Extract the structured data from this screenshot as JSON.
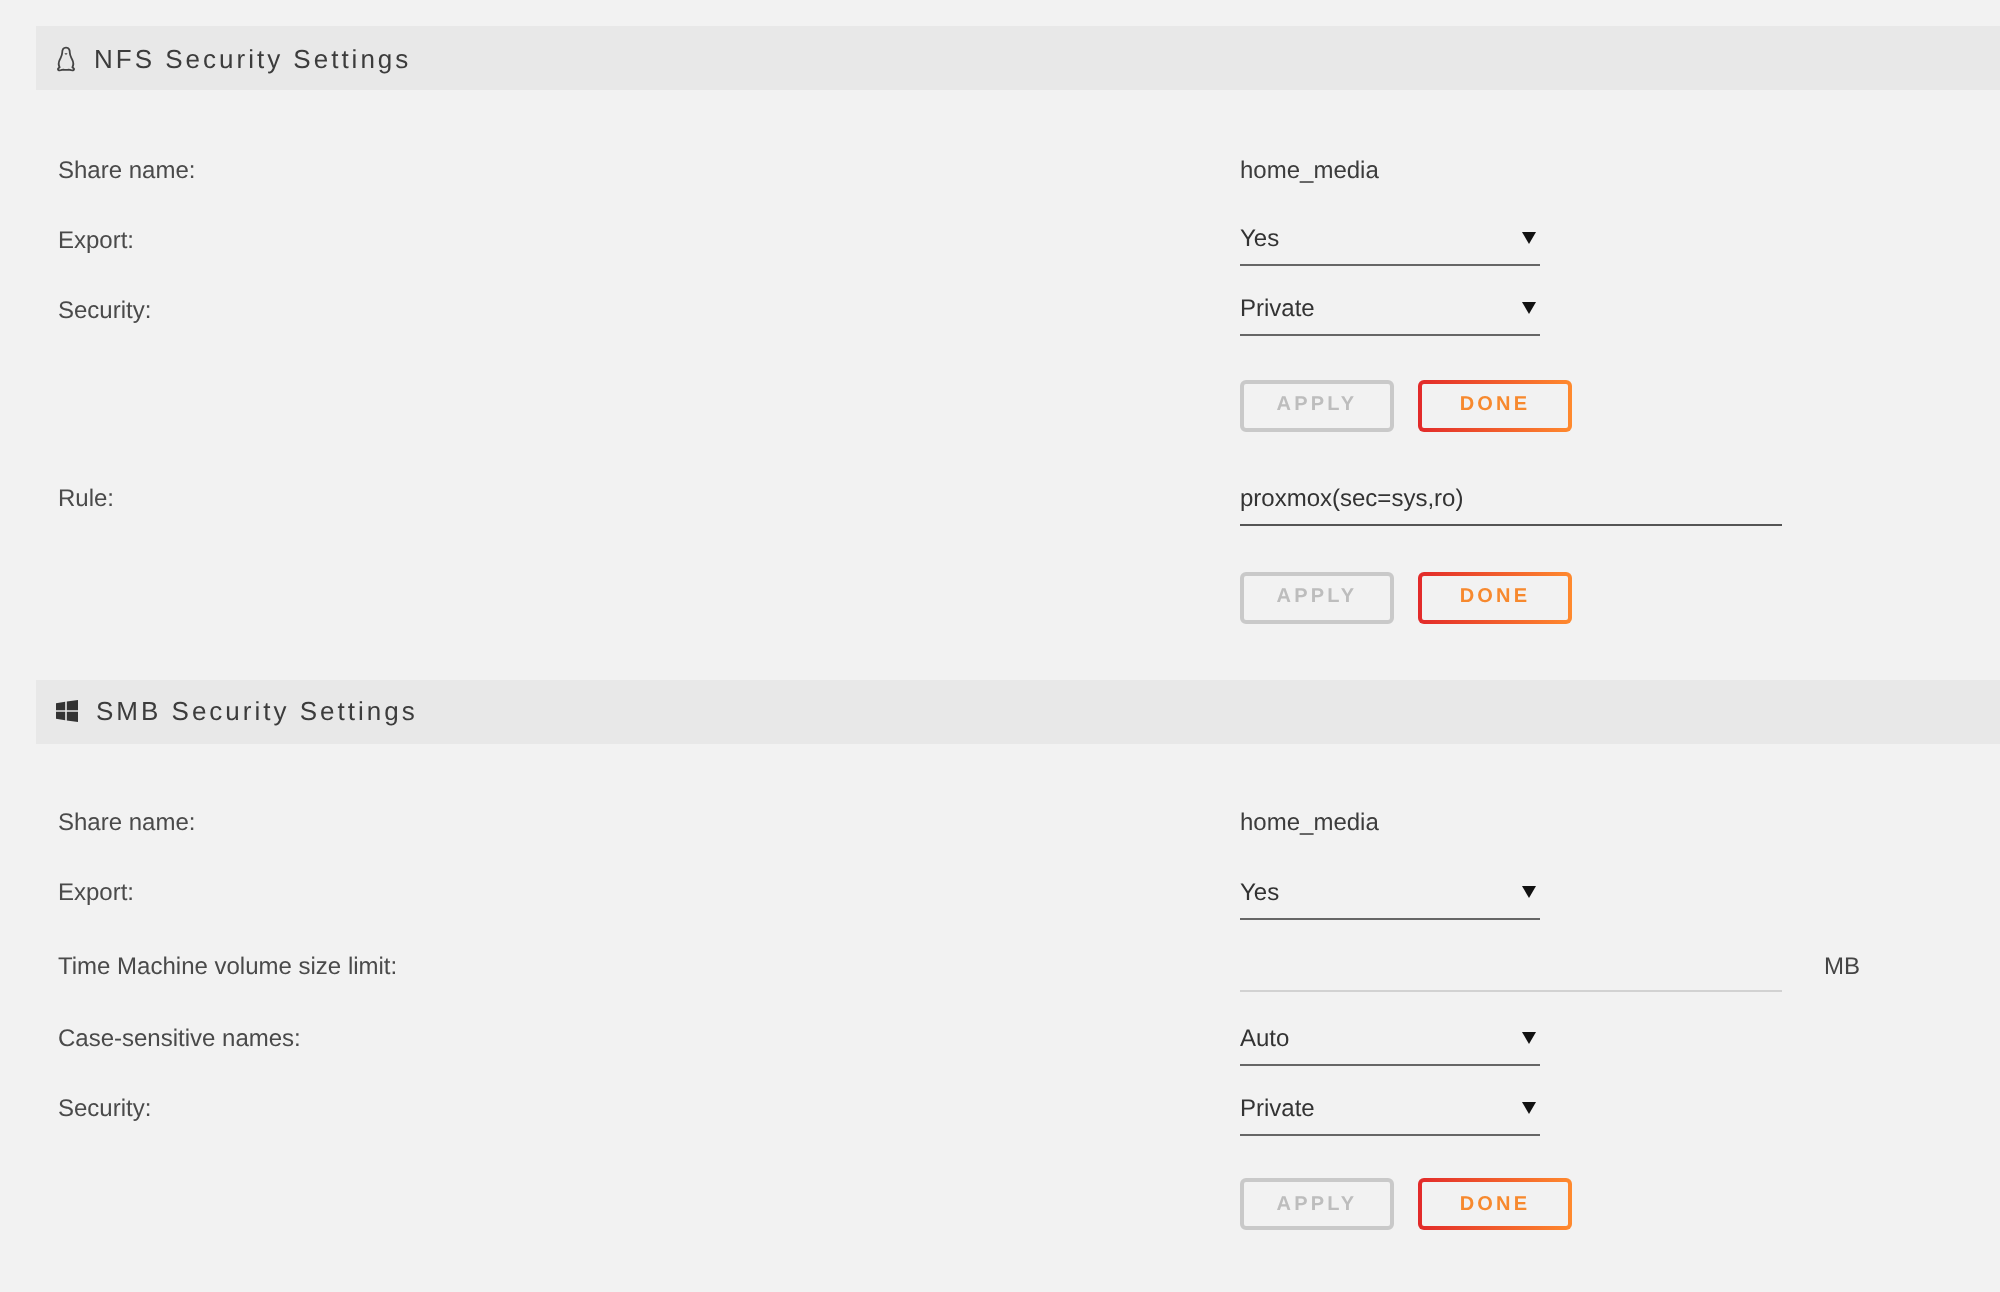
{
  "sections": [
    {
      "kind": "nfs",
      "title": "NFS Security Settings",
      "rows": [
        {
          "kind": "text",
          "label": "Share name:",
          "value": "home_media"
        },
        {
          "kind": "select",
          "label": "Export:",
          "value": "Yes"
        },
        {
          "kind": "select",
          "label": "Security:",
          "value": "Private"
        },
        {
          "kind": "buttons",
          "buttons": [
            {
              "label": "APPLY",
              "disabled": true
            },
            {
              "label": "DONE",
              "disabled": false
            }
          ]
        },
        {
          "kind": "input",
          "label": "Rule:",
          "value": "proxmox(sec=sys,ro)"
        },
        {
          "kind": "buttons",
          "buttons": [
            {
              "label": "APPLY",
              "disabled": true
            },
            {
              "label": "DONE",
              "disabled": false
            }
          ]
        }
      ]
    },
    {
      "kind": "smb",
      "title": "SMB Security Settings",
      "rows": [
        {
          "kind": "text",
          "label": "Share name:",
          "value": "home_media"
        },
        {
          "kind": "select",
          "label": "Export:",
          "value": "Yes"
        },
        {
          "kind": "input",
          "label": "Time Machine volume size limit:",
          "unit": "MB"
        },
        {
          "kind": "select",
          "label": "Case-sensitive names:",
          "value": "Auto"
        },
        {
          "kind": "select",
          "label": "Security:",
          "value": "Private"
        },
        {
          "kind": "buttons",
          "buttons": [
            {
              "label": "APPLY",
              "disabled": true
            },
            {
              "label": "DONE",
              "disabled": false
            }
          ]
        }
      ]
    }
  ]
}
